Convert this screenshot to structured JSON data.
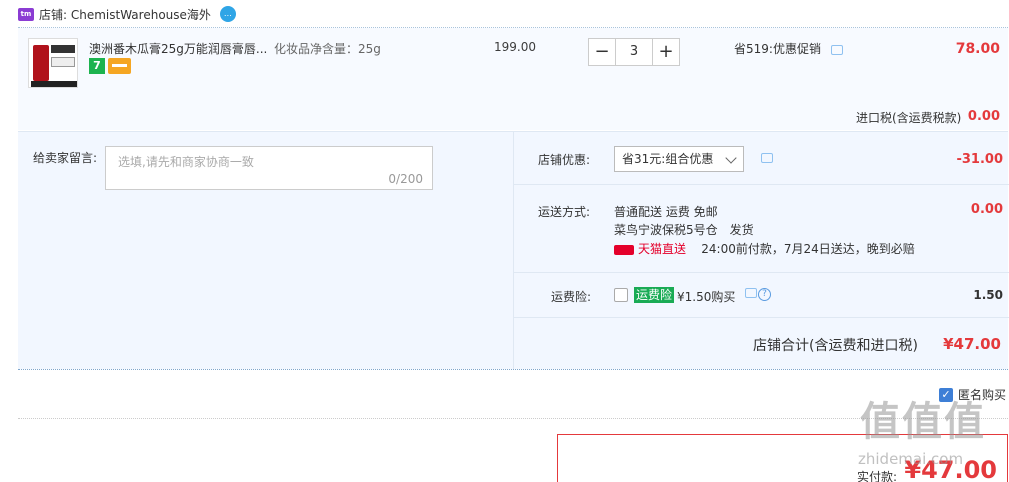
{
  "store": {
    "icon": "store-icon",
    "label": "店铺: ChemistWarehouse海外",
    "wangwang_icon": "chat-bubble-icon"
  },
  "item": {
    "title": "澳洲番木瓜膏25g万能润唇膏唇...",
    "spec": "化妆品净含量：25g",
    "unit_price": "199.00",
    "quantity": "3",
    "minus_label": "−",
    "plus_label": "+",
    "promo": "省519:优惠促销",
    "total": "78.00",
    "badge_7": "7",
    "tax_label": "进口税(含运费税款)",
    "tax_value": "0.00"
  },
  "message": {
    "label": "给卖家留言:",
    "placeholder": "选填,请先和商家协商一致",
    "count": "0/200"
  },
  "shop_discount": {
    "label": "店铺优惠:",
    "selected": "省31元:组合优惠",
    "value": "-31.00"
  },
  "shipping": {
    "label": "运送方式:",
    "line1": "普通配送 运费 免邮",
    "line2": "菜鸟宁波保税5号仓　发货",
    "tmall_tag": "天猫直送",
    "line3": "24:00前付款，7月24日送达，晚到必赔",
    "value": "0.00"
  },
  "insurance": {
    "label": "运费险:",
    "tag": "运费险",
    "text": "¥1.50购买",
    "value": "1.50"
  },
  "subtotal": {
    "label": "店铺合计(含运费和进口税)",
    "value": "¥47.00"
  },
  "anonymous": {
    "label": "匿名购买",
    "checked": true
  },
  "payment": {
    "label": "实付款:",
    "value": "¥47.00"
  },
  "watermark": {
    "logo": "值值值",
    "site": "zhidemai.com"
  },
  "colors": {
    "price_red": "#e4393c",
    "accent_blue": "#3e7fd6",
    "tmall_red": "#e4002b",
    "insurance_green": "#1aab55"
  }
}
